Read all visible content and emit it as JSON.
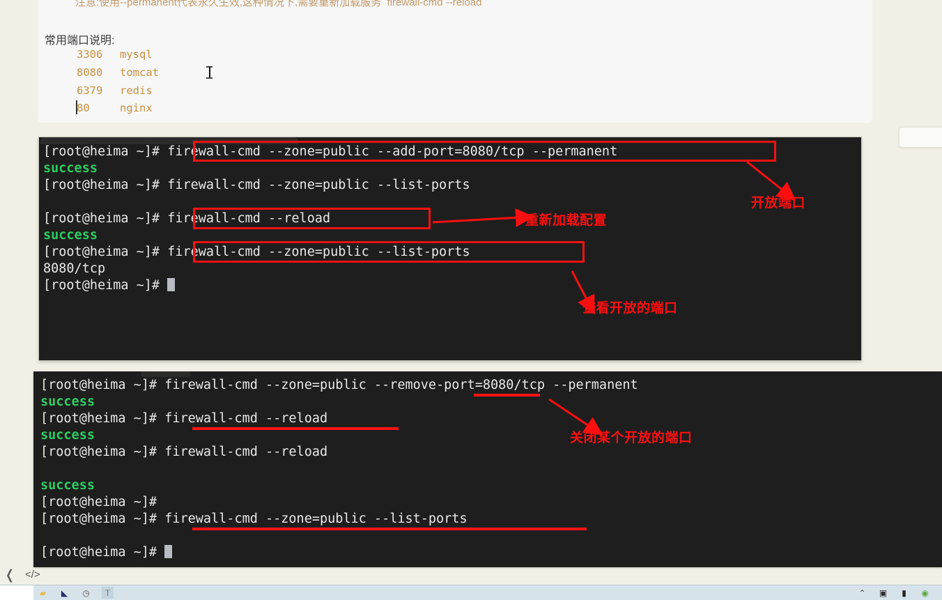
{
  "document": {
    "top_note": "注意:使用--permanent代表永久生效,这种情况下,需要重新加载服务  firewall-cmd --reload",
    "heading": "常用端口说明:",
    "ports": [
      {
        "port": "3306",
        "service": "mysql"
      },
      {
        "port": "8080",
        "service": "tomcat"
      },
      {
        "port": "6379",
        "service": "redis"
      },
      {
        "port": "80",
        "service": "nginx"
      }
    ]
  },
  "terminal1": {
    "lines": [
      {
        "text": "[root@heima ~]# firewall-cmd --zone=public --add-port=8080/tcp --permanent",
        "kind": "prompt"
      },
      {
        "text": "success",
        "kind": "ok"
      },
      {
        "text": "[root@heima ~]# firewall-cmd --zone=public --list-ports",
        "kind": "prompt"
      },
      {
        "text": "",
        "kind": "blank"
      },
      {
        "text": "[root@heima ~]# firewall-cmd --reload",
        "kind": "prompt"
      },
      {
        "text": "success",
        "kind": "ok"
      },
      {
        "text": "[root@heima ~]# firewall-cmd --zone=public --list-ports",
        "kind": "prompt"
      },
      {
        "text": "8080/tcp",
        "kind": "output"
      },
      {
        "text": "[root@heima ~]# ",
        "kind": "prompt-cursor"
      }
    ],
    "annotations": [
      {
        "label": "开放端口"
      },
      {
        "label": "重新加载配置"
      },
      {
        "label": "查看开放的端口"
      }
    ]
  },
  "terminal2": {
    "lines": [
      {
        "text": "[root@heima ~]# firewall-cmd --zone=public --remove-port=8080/tcp --permanent",
        "kind": "prompt"
      },
      {
        "text": "success",
        "kind": "ok"
      },
      {
        "text": "[root@heima ~]# firewall-cmd --reload",
        "kind": "prompt"
      },
      {
        "text": "success",
        "kind": "ok"
      },
      {
        "text": "[root@heima ~]# firewall-cmd --reload",
        "kind": "prompt"
      },
      {
        "text": "",
        "kind": "blank"
      },
      {
        "text": "success",
        "kind": "ok"
      },
      {
        "text": "[root@heima ~]#",
        "kind": "prompt"
      },
      {
        "text": "[root@heima ~]# firewall-cmd --zone=public --list-ports",
        "kind": "prompt"
      },
      {
        "text": "",
        "kind": "blank"
      },
      {
        "text": "[root@heima ~]# ",
        "kind": "prompt-cursor"
      }
    ],
    "annotations": [
      {
        "label": "关闭某个开放的端口"
      }
    ]
  },
  "nav": {
    "back_glyph": "❬",
    "code_glyph": "</>"
  },
  "taskbar": {
    "left_icons": [
      {
        "name": "browser-icon",
        "glyph": "◉"
      },
      {
        "name": "file-explorer-icon",
        "glyph": "▰"
      },
      {
        "name": "media-player-icon",
        "glyph": "◣"
      },
      {
        "name": "clock-icon",
        "glyph": "◷"
      },
      {
        "name": "text-tool-icon",
        "glyph": "T"
      }
    ],
    "right_icons": [
      {
        "name": "chevron-up-icon",
        "glyph": "⌃"
      },
      {
        "name": "film-icon",
        "glyph": "▣"
      },
      {
        "name": "battery-icon",
        "glyph": "▮"
      },
      {
        "name": "green-status-icon",
        "glyph": "◉"
      }
    ]
  },
  "colors": {
    "page_bg": "#f0f0e6",
    "terminal_bg": "#1e1e1e",
    "terminal_fg": "#e8e8e8",
    "success_green": "#2ecc63",
    "annotation_red": "#fb0f0f",
    "code_amber": "#c8913f",
    "taskbar_bg": "#d7e3ea"
  }
}
